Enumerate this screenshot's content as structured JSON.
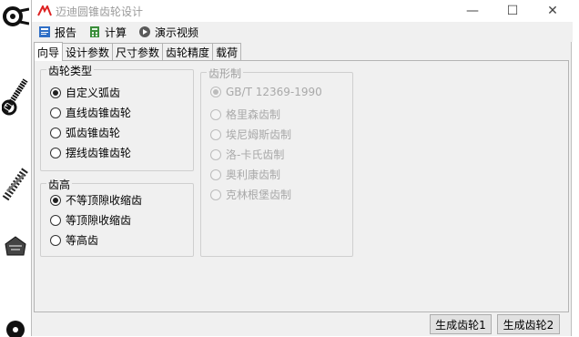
{
  "window": {
    "title": "迈迪圆锥齿轮设计"
  },
  "toolbar": {
    "report_label": "报告",
    "calc_label": "计算",
    "demo_label": "演示视频"
  },
  "tabs": [
    {
      "label": "向导",
      "active": true
    },
    {
      "label": "设计参数",
      "active": false
    },
    {
      "label": "尺寸参数",
      "active": false
    },
    {
      "label": "齿轮精度",
      "active": false
    },
    {
      "label": "载荷",
      "active": false
    }
  ],
  "gear_type": {
    "title": "齿轮类型",
    "options": [
      {
        "label": "自定义弧齿",
        "checked": true
      },
      {
        "label": "直线齿锥齿轮",
        "checked": false
      },
      {
        "label": "弧齿锥齿轮",
        "checked": false
      },
      {
        "label": "摆线齿锥齿轮",
        "checked": false
      }
    ]
  },
  "tooth_height": {
    "title": "齿高",
    "options": [
      {
        "label": "不等顶隙收缩齿",
        "checked": true
      },
      {
        "label": "等顶隙收缩齿",
        "checked": false
      },
      {
        "label": "等高齿",
        "checked": false
      }
    ]
  },
  "tooth_system": {
    "title": "齿形制",
    "enabled": false,
    "options": [
      {
        "label": "GB/T 12369-1990",
        "checked": true
      },
      {
        "label": "格里森齿制",
        "checked": false
      },
      {
        "label": "埃尼姆斯齿制",
        "checked": false
      },
      {
        "label": "洛-卡氏齿制",
        "checked": false
      },
      {
        "label": "奥利康齿制",
        "checked": false
      },
      {
        "label": "克林根堡齿制",
        "checked": false
      }
    ]
  },
  "buttons": {
    "generate1": "生成齿轮1",
    "generate2": "生成齿轮2"
  }
}
